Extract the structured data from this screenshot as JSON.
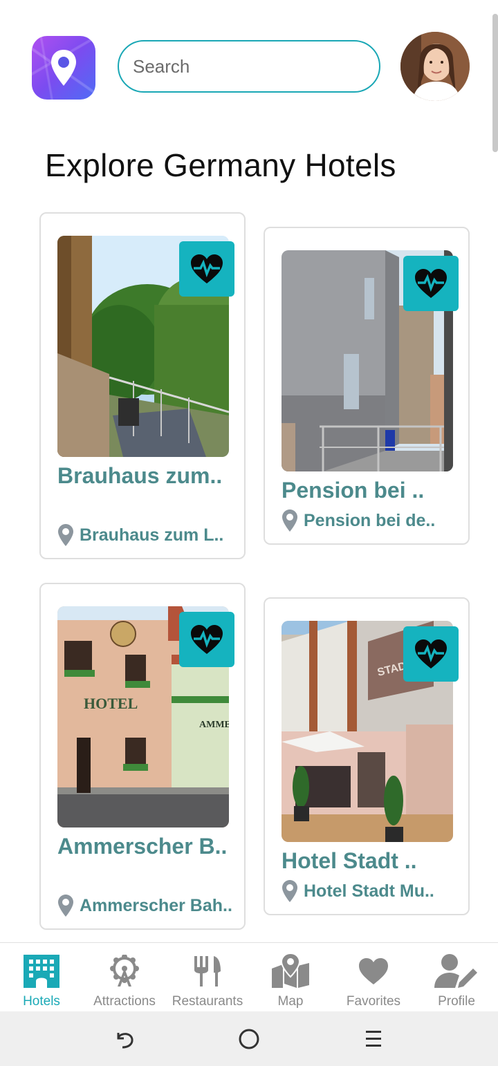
{
  "header": {
    "logo_icon": "map-pin-icon",
    "search_placeholder": "Search",
    "avatar_icon": "user-avatar"
  },
  "title": "Explore Germany Hotels",
  "hotels": [
    {
      "name": "Brauhaus zum..",
      "location": "Brauhaus zum L..",
      "fav_icon": "heart-pulse-icon"
    },
    {
      "name": "Pension bei ..",
      "location": "Pension bei de..",
      "fav_icon": "heart-pulse-icon"
    },
    {
      "name": "Ammerscher B..",
      "location": "Ammerscher Bah..",
      "fav_icon": "heart-pulse-icon"
    },
    {
      "name": "Hotel Stadt ..",
      "location": "Hotel Stadt Mu..",
      "fav_icon": "heart-pulse-icon"
    }
  ],
  "photo_signs": {
    "hotel": "HOTEL",
    "ammer": "AMMER",
    "stadt": "STADTMU"
  },
  "nav": [
    {
      "label": "Hotels",
      "icon": "hotel-icon",
      "active": true
    },
    {
      "label": "Attractions",
      "icon": "ferris-wheel-icon"
    },
    {
      "label": "Restaurants",
      "icon": "fork-knife-icon"
    },
    {
      "label": "Map",
      "icon": "map-icon"
    },
    {
      "label": "Favorites",
      "icon": "heart-icon"
    },
    {
      "label": "Profile",
      "icon": "user-edit-icon"
    }
  ],
  "colors": {
    "accent": "#15b3bf",
    "hotel_text": "#4c8a8c",
    "search_border": "#19a7b5",
    "nav_inactive": "#8a8a8a"
  }
}
